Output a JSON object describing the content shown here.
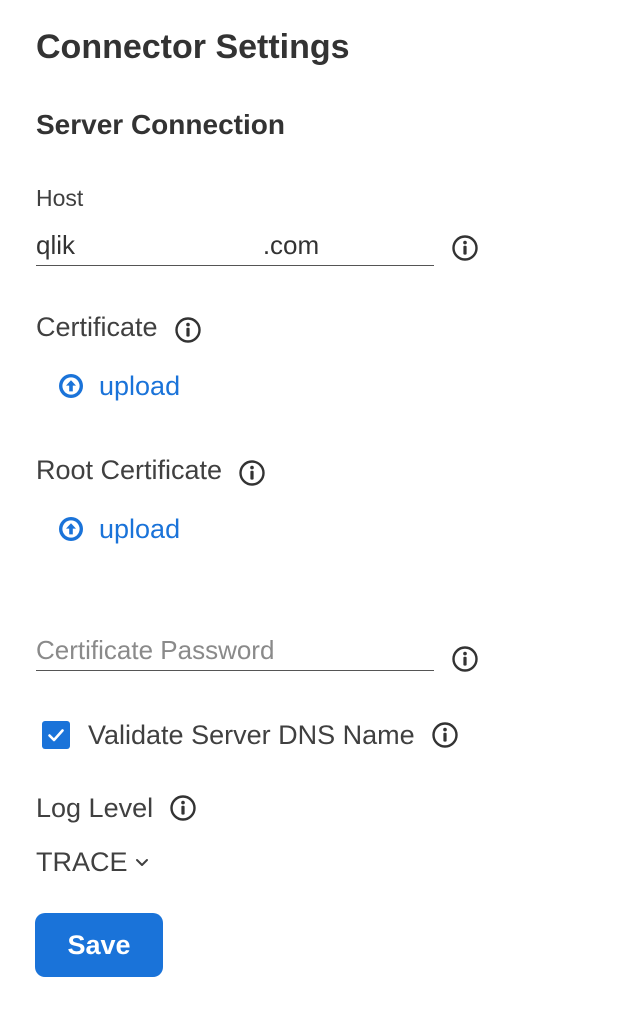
{
  "page": {
    "title": "Connector Settings"
  },
  "server_connection": {
    "heading": "Server Connection",
    "host": {
      "label": "Host",
      "value": "qlik                          .com"
    },
    "certificate": {
      "label": "Certificate",
      "upload_label": "upload"
    },
    "root_certificate": {
      "label": "Root Certificate",
      "upload_label": "upload"
    },
    "certificate_password": {
      "placeholder": "Certificate Password",
      "value": ""
    },
    "validate_dns": {
      "label": "Validate Server DNS Name",
      "checked": true
    },
    "log_level": {
      "label": "Log Level",
      "selected": "TRACE"
    }
  },
  "actions": {
    "save_label": "Save"
  },
  "icons": {
    "info": "info-circle-icon",
    "upload": "upload-arrow-circle-icon",
    "checkmark": "checkmark-icon",
    "chevron": "chevron-down-icon"
  },
  "colors": {
    "accent": "#1a73d9",
    "text": "#333333",
    "label": "#404040",
    "placeholder": "#8a8a8a",
    "background": "#ffffff"
  }
}
